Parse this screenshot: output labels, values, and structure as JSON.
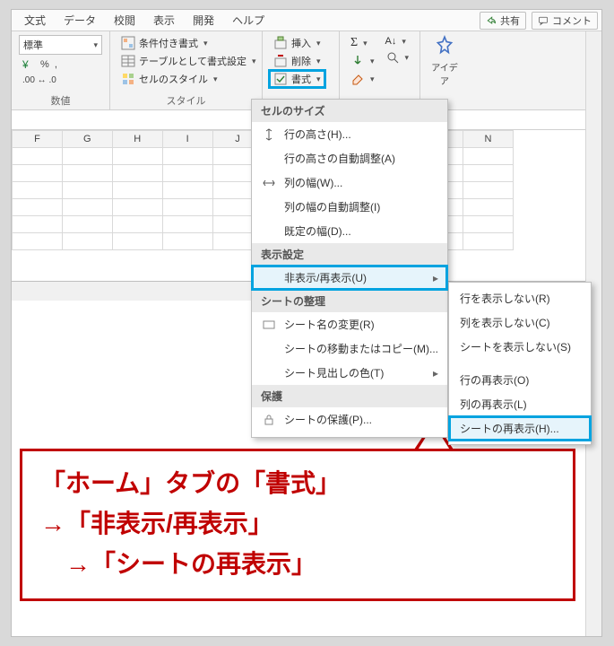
{
  "tabs": {
    "t1": "文式",
    "t2": "データ",
    "t3": "校閲",
    "t4": "表示",
    "t5": "開発",
    "t6": "ヘルプ"
  },
  "topbtn": {
    "share": "共有",
    "comment": "コメント"
  },
  "ribbon": {
    "number": {
      "label": "数値",
      "style": "標準"
    },
    "styles": {
      "label": "スタイル",
      "cond": "条件付き書式",
      "table": "テーブルとして書式設定",
      "cell": "セルのスタイル"
    },
    "cells": {
      "insert": "挿入",
      "delete": "削除",
      "format": "書式"
    },
    "editing": {
      "label": ""
    },
    "idea": {
      "label": "アイデア"
    }
  },
  "grid": {
    "cols": [
      "F",
      "G",
      "H",
      "I",
      "J",
      "",
      "",
      "",
      "",
      "N"
    ]
  },
  "menu": {
    "h_size": "セルのサイズ",
    "rowheight": "行の高さ(H)...",
    "autoheight": "行の高さの自動調整(A)",
    "colwidth": "列の幅(W)...",
    "autowidth": "列の幅の自動調整(I)",
    "defwidth": "既定の幅(D)...",
    "h_vis": "表示設定",
    "hide": "非表示/再表示(U)",
    "h_org": "シートの整理",
    "rename": "シート名の変更(R)",
    "move": "シートの移動またはコピー(M)...",
    "tabcolor": "シート見出しの色(T)",
    "h_prot": "保護",
    "protect": "シートの保護(P)..."
  },
  "submenu": {
    "hiderow": "行を表示しない(R)",
    "hidecol": "列を表示しない(C)",
    "hidesheet": "シートを表示しない(S)",
    "unhiderow": "行の再表示(O)",
    "unhidecol": "列の再表示(L)",
    "unhidesheet": "シートの再表示(H)..."
  },
  "callout": {
    "l1": "「ホーム」タブの「書式」",
    "l2": "→「非表示/再表示」",
    "l3": "　→「シートの再表示」"
  }
}
